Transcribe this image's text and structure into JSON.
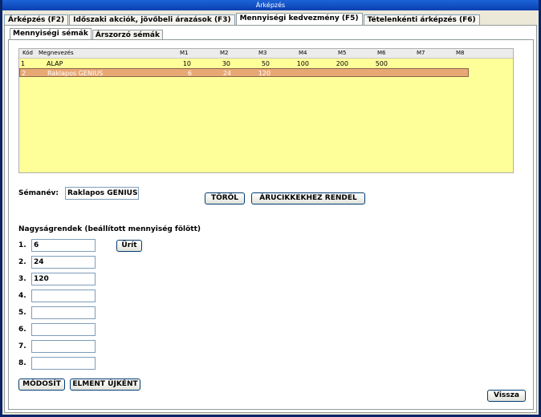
{
  "window": {
    "title": "Árképzés"
  },
  "main_tabs": [
    {
      "label": "Árképzés (F2)"
    },
    {
      "label": "Időszaki akciók, jövőbeli árazások (F3)"
    },
    {
      "label": "Mennyiségi kedvezmény (F5)",
      "active": true
    },
    {
      "label": "Tételenkénti árképzés (F6)"
    }
  ],
  "sub_tabs": [
    {
      "label": "Mennyiségi sémák",
      "active": true
    },
    {
      "label": "Árszorzó sémák"
    }
  ],
  "grid": {
    "headers": [
      "Kód",
      "Megnevezés",
      "M1",
      "M2",
      "M3",
      "M4",
      "M5",
      "M6",
      "M7",
      "M8"
    ],
    "rows": [
      {
        "kod": "1",
        "nev": "ALAP",
        "m": [
          "10",
          "30",
          "50",
          "100",
          "200",
          "500",
          "",
          ""
        ]
      },
      {
        "kod": "2",
        "nev": "Raklapos GENIUS",
        "m": [
          "6",
          "24",
          "120",
          "",
          "",
          "",
          "",
          ""
        ],
        "selected": true
      }
    ]
  },
  "form": {
    "semanev_label": "Sémanév:",
    "semanev_value": "Raklapos GENIUS",
    "torol_button": "TÖRÖL",
    "arucikk_button": "ÁRUCIKKEKHEZ RENDEL",
    "nagysag_title": "Nagyságrendek (beállított mennyiség fölött)",
    "urit_button": "Ürít",
    "levels": [
      {
        "label": "1.",
        "value": "6"
      },
      {
        "label": "2.",
        "value": "24"
      },
      {
        "label": "3.",
        "value": "120"
      },
      {
        "label": "4.",
        "value": ""
      },
      {
        "label": "5.",
        "value": ""
      },
      {
        "label": "6.",
        "value": ""
      },
      {
        "label": "7.",
        "value": ""
      },
      {
        "label": "8.",
        "value": ""
      }
    ],
    "modosit_button": "MÓDOSÍT",
    "uj_button": "ELMENT ÚJKÉNT",
    "vissza_button": "Vissza"
  },
  "colors": {
    "grid_background": "#ffff99",
    "selected_row": "#e8a874",
    "titlebar": "#0a3fb0"
  }
}
